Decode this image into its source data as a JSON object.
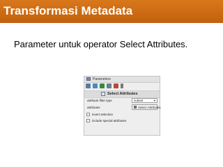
{
  "slide": {
    "title": "Transformasi Metadata",
    "subtitle": "Parameter untuk operator Select Attributes."
  },
  "colors": {
    "title_bar": "#c96a12",
    "title_text": "#ffffff",
    "panel_bg": "#eeeeee"
  },
  "panel": {
    "header_label": "Parameters",
    "toolbar_icons": [
      "settings-icon",
      "expand-icon",
      "run-icon",
      "tree-icon",
      "error-icon",
      "menu-icon"
    ],
    "operator_name": "Select Attributes",
    "params": {
      "filter_type_label": "attribute filter type",
      "filter_type_value": "subset",
      "attributes_label": "attributes",
      "attributes_button": "Select Attributes"
    },
    "checkboxes": {
      "invert_selection": "invert selection",
      "include_special": "include special attributes"
    }
  }
}
